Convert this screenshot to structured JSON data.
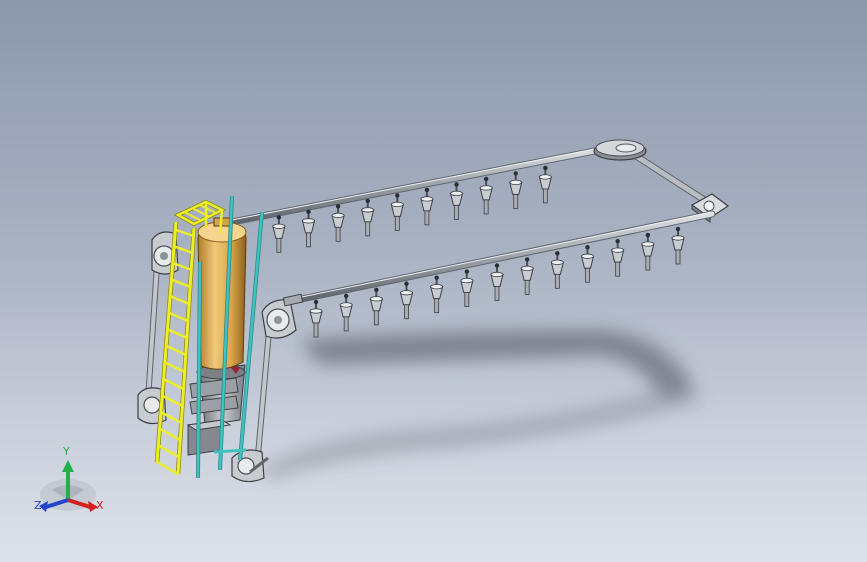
{
  "triad": {
    "x_label": "X",
    "y_label": "Y",
    "z_label": "Z",
    "x_color": "#d51f1f",
    "y_color": "#22b04a",
    "z_color": "#2546c8"
  },
  "colors": {
    "background_top": "#8d98ab",
    "background_bottom": "#dde1e9",
    "ladder": "#e6e622",
    "tank": "#e3b15a",
    "support_post": "#3fc3c0",
    "rail": "#a4a8ad",
    "nozzle": "#c7cace"
  },
  "icons": {
    "triad": "coordinate-axes-icon"
  }
}
